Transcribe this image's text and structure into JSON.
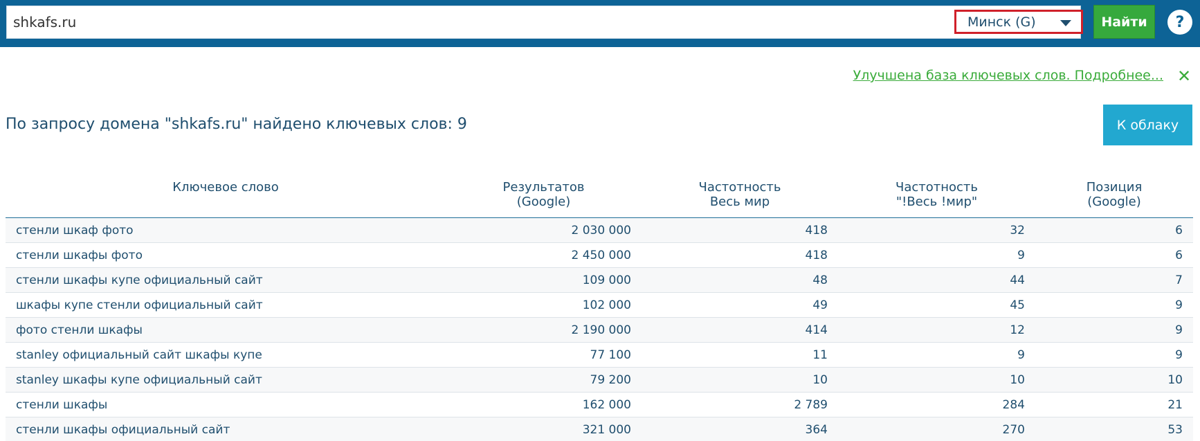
{
  "search": {
    "value": "shkafs.ru",
    "region_label": "Минск (G)",
    "button_label": "Найти",
    "help_label": "?"
  },
  "notice": {
    "text": "Улучшена база ключевых слов. Подробнее...",
    "close_label": "✕"
  },
  "results": {
    "title": "По запросу домена \"shkafs.ru\" найдено ключевых слов: 9",
    "cloud_button": "К облаку"
  },
  "table": {
    "headers": {
      "keyword": "Ключевое слово",
      "results_line1": "Результатов",
      "results_line2": "(Google)",
      "freq_world_line1": "Частотность",
      "freq_world_line2": "Весь мир",
      "freq_exact_line1": "Частотность",
      "freq_exact_line2": "\"!Весь !мир\"",
      "position_line1": "Позиция",
      "position_line2": "(Google)"
    },
    "rows": [
      {
        "keyword": "стенли шкаф фото",
        "results": "2 030 000",
        "freq_world": "418",
        "freq_exact": "32",
        "position": "6"
      },
      {
        "keyword": "стенли шкафы фото",
        "results": "2 450 000",
        "freq_world": "418",
        "freq_exact": "9",
        "position": "6"
      },
      {
        "keyword": "стенли шкафы купе официальный сайт",
        "results": "109 000",
        "freq_world": "48",
        "freq_exact": "44",
        "position": "7"
      },
      {
        "keyword": "шкафы купе стенли официальный сайт",
        "results": "102 000",
        "freq_world": "49",
        "freq_exact": "45",
        "position": "9"
      },
      {
        "keyword": "фото стенли шкафы",
        "results": "2 190 000",
        "freq_world": "414",
        "freq_exact": "12",
        "position": "9"
      },
      {
        "keyword": "stanley официальный сайт шкафы купе",
        "results": "77 100",
        "freq_world": "11",
        "freq_exact": "9",
        "position": "9"
      },
      {
        "keyword": "stanley шкафы купе официальный сайт",
        "results": "79 200",
        "freq_world": "10",
        "freq_exact": "10",
        "position": "10"
      },
      {
        "keyword": "стенли шкафы",
        "results": "162 000",
        "freq_world": "2 789",
        "freq_exact": "284",
        "position": "21"
      },
      {
        "keyword": "стенли шкафы официальный сайт",
        "results": "321 000",
        "freq_world": "364",
        "freq_exact": "270",
        "position": "53"
      }
    ]
  },
  "colors": {
    "topbar": "#0d6396",
    "accent_green": "#36a93d",
    "link_green": "#3aab3a",
    "cloud_button": "#22a8d0",
    "region_highlight": "#d0202a",
    "text": "#1f4e6e"
  }
}
